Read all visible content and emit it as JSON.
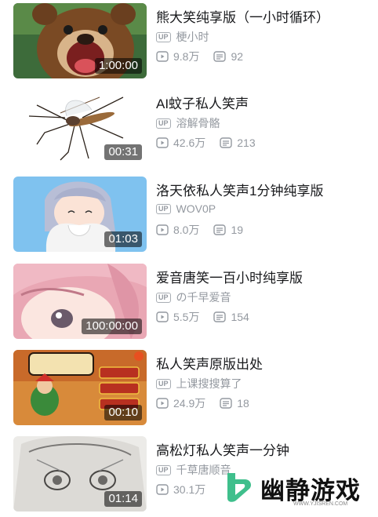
{
  "videos": [
    {
      "title": "熊大笑纯享版（一小时循环）",
      "uploader": "梗小时",
      "views": "9.8万",
      "comments": "92",
      "duration": "1:00:00",
      "thumb": "bear"
    },
    {
      "title": "AI蚊子私人笑声",
      "uploader": "溶解骨骼",
      "views": "42.6万",
      "comments": "213",
      "duration": "00:31",
      "thumb": "mosquito"
    },
    {
      "title": "洛天依私人笑声1分钟纯享版",
      "uploader": "WOV0P",
      "views": "8.0万",
      "comments": "19",
      "duration": "01:03",
      "thumb": "anime-blue"
    },
    {
      "title": "爱音唐笑一百小时纯享版",
      "uploader": "の千早爱音",
      "views": "5.5万",
      "comments": "154",
      "duration": "100:00:00",
      "thumb": "anime-pink"
    },
    {
      "title": "私人笑声原版出处",
      "uploader": "上课搜搜算了",
      "views": "24.9万",
      "comments": "18",
      "duration": "00:10",
      "thumb": "game"
    },
    {
      "title": "高松灯私人笑声一分钟",
      "uploader": "千草唐顺音",
      "views": "30.1万",
      "comments": "",
      "duration": "01:14",
      "thumb": "sketch"
    }
  ],
  "badge_label": "UP",
  "icons": {
    "play": "play-count-icon",
    "comment": "comment-count-icon"
  },
  "watermark": {
    "text": "幽静游戏",
    "url": "WWW.YJISREN.COM",
    "color": "#3fbf8c"
  },
  "colors": {
    "title": "#18191c",
    "meta": "#9499a0"
  }
}
